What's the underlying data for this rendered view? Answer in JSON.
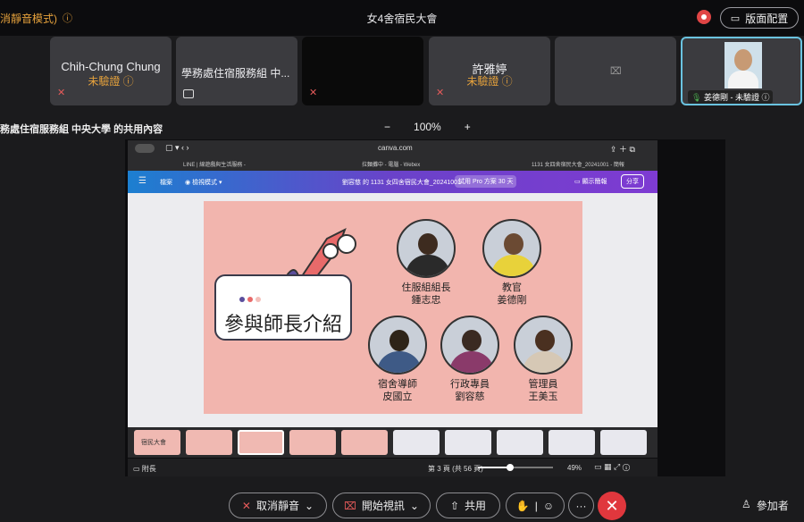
{
  "topbar": {
    "left_note": "消靜音模式)",
    "title": "女4舍宿民大會",
    "layout_button": "版面配置"
  },
  "tiles": [
    {
      "name": "Chih-Chung Chung",
      "status": "未驗證"
    },
    {
      "name": "學務處住宿服務組 中..."
    },
    {
      "name": ""
    },
    {
      "name": "許雅婷",
      "status": "未驗證"
    },
    {
      "name": ""
    },
    {
      "name": "姜德剛 - 未驗證"
    }
  ],
  "share": {
    "label": "務處住宿服務組 中央大學 的共用內容",
    "zoom_minus": "−",
    "zoom_value": "100%",
    "zoom_plus": "+"
  },
  "browser": {
    "url": "canva.com",
    "tab1": "LINE | 線遊戲與生活服務 -",
    "tab2": "拉麵攤中 - 電腦 - Webex",
    "tab3": "1131 女四舍宿民大會_20241001 - 簡報"
  },
  "canva": {
    "file_menu": "檔案",
    "view_mode": "檢視模式",
    "doc_title": "劉容慈 的 1131 女四舍宿民大會_20241001",
    "trial": "試用 Pro 方案 30 天",
    "present": "顯示簡報",
    "share": "分享"
  },
  "slide": {
    "heading": "參與師長介紹",
    "people": [
      {
        "role": "住服組組長",
        "name": "鍾志忠"
      },
      {
        "role": "教官",
        "name": "姜德剛"
      },
      {
        "role": "宿舍導師",
        "name": "皮國立"
      },
      {
        "role": "行政專員",
        "name": "劉容慈"
      },
      {
        "role": "管理員",
        "name": "王美玉"
      }
    ]
  },
  "thumbnails": [
    "宿民大會",
    "",
    "",
    "",
    "",
    "",
    "",
    "",
    "",
    "",
    ""
  ],
  "status_bar": {
    "notes": "附長",
    "page": "第 3 頁 (共 56 頁)",
    "zoom": "49%"
  },
  "controls": {
    "unmute": "取消靜音",
    "start_video": "開始視訊",
    "share": "共用",
    "participants": "參加者"
  },
  "colors": {
    "accent_unverified": "#e6a23c",
    "hangup": "#e0373d",
    "slide_bg": "#f2b5ae"
  }
}
